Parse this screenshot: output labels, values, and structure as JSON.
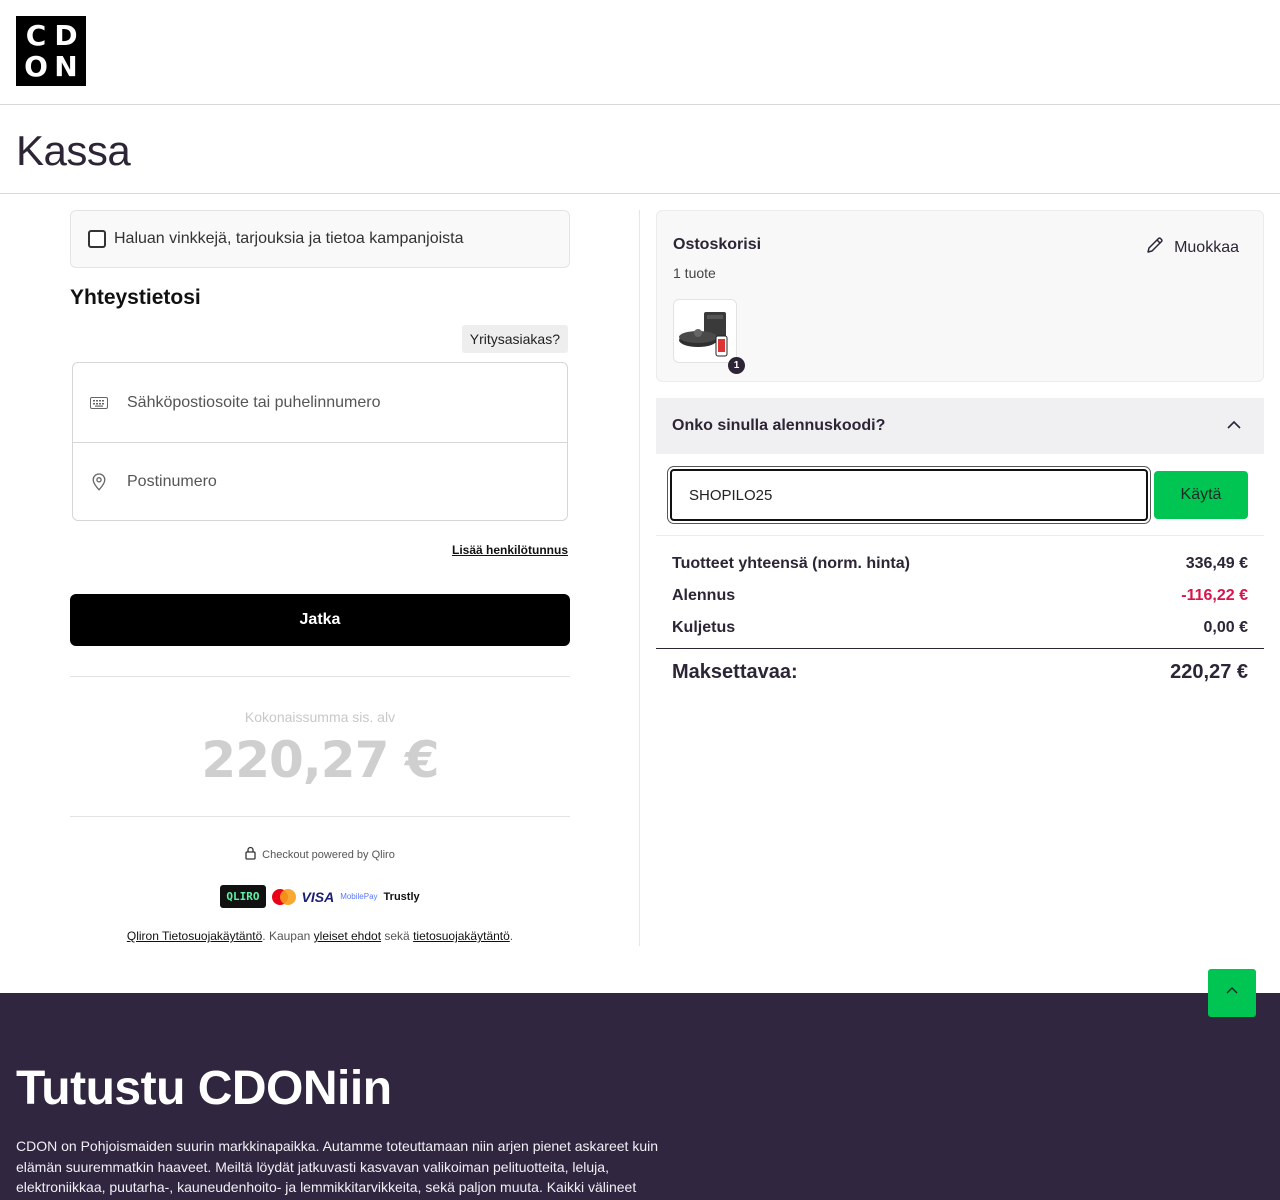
{
  "logo": {
    "letters": [
      "C",
      "D",
      "O",
      "N"
    ]
  },
  "page_title": "Kassa",
  "newsletter": {
    "label": "Haluan vinkkejä, tarjouksia ja tietoa kampanjoista"
  },
  "contact": {
    "title": "Yhteystietosi",
    "company_button": "Yritysasiakas?",
    "email_placeholder": "Sähköpostiosoite tai puhelinnumero",
    "postcode_placeholder": "Postinumero",
    "add_id_link": "Lisää henkilötunnus",
    "continue_button": "Jatka"
  },
  "total": {
    "label": "Kokonaissumma sis. alv",
    "amount": "220,27 €"
  },
  "powered_by": "Checkout powered by Qliro",
  "payment_logos": {
    "qliro": "QLIRO",
    "visa": "VISA",
    "mobilepay": "MobilePay",
    "trustly": "Trustly"
  },
  "legal": {
    "qliro_privacy": "Qliron Tietosuojakäytäntö",
    "text1": ". Kaupan ",
    "terms": "yleiset ehdot",
    "text2": " sekä ",
    "privacy": "tietosuojakäytäntö",
    "text3": "."
  },
  "cart": {
    "title": "Ostoskorisi",
    "count": "1 tuote",
    "edit": "Muokkaa",
    "badge": "1"
  },
  "discount": {
    "question": "Onko sinulla alennuskoodi?",
    "code_value": "SHOPILO25",
    "apply_button": "Käytä"
  },
  "summary": {
    "rows": [
      {
        "label": "Tuotteet yhteensä (norm. hinta)",
        "value": "336,49 €"
      },
      {
        "label": "Alennus",
        "value": "-116,22 €"
      },
      {
        "label": "Kuljetus",
        "value": "0,00 €"
      }
    ],
    "grand_label": "Maksettavaa:",
    "grand_value": "220,27 €"
  },
  "footer": {
    "title": "Tutustu CDONiin",
    "text": "CDON on Pohjoismaiden suurin markkinapaikka. Autamme toteuttamaan niin arjen pienet askareet kuin elämän suuremmatkin haaveet. Meiltä löydät jatkuvasti kasvavan valikoiman pelituotteita, leluja, elektroniikkaa, puutarha-, kauneudenhoito- ja lemmikkitarvikkeita, sekä paljon muuta. Kaikki välineet"
  },
  "colors": {
    "accent_green": "#00c552",
    "footer_bg": "#302640",
    "discount_red": "#d8124a"
  },
  "icons": [
    "keyboard-icon",
    "location-pin-icon",
    "pencil-icon",
    "chevron-up-icon",
    "lock-icon",
    "arrow-up-icon"
  ]
}
